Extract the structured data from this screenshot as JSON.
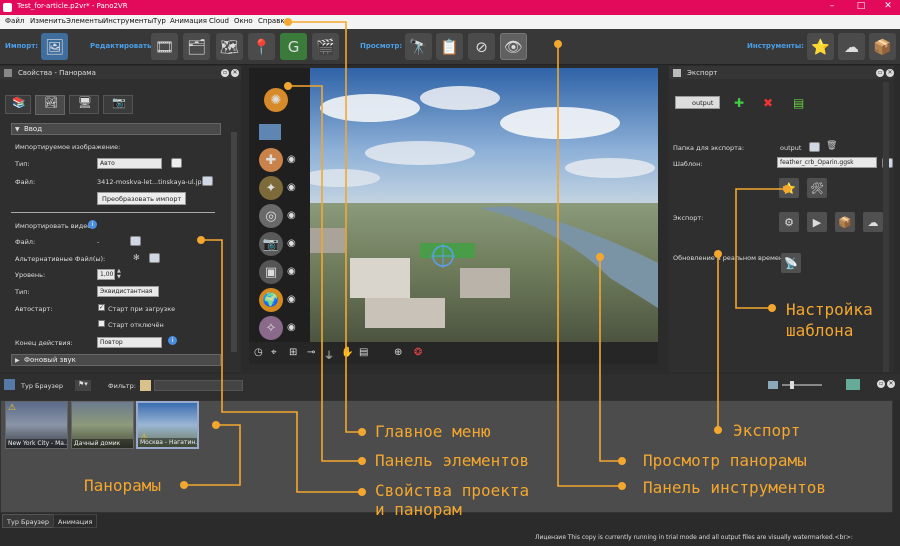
{
  "window": {
    "title": "Test_for-article.p2vr* - Pano2VR"
  },
  "menu": [
    "Файл",
    "Изменить",
    "Элементы",
    "Инструменты",
    "Тур",
    "Анимация",
    "Cloud",
    "Окно",
    "Справка"
  ],
  "toolbar": {
    "import_label": "Импорт:",
    "edit_label": "Редактировать:",
    "view_label": "Просмотр:",
    "tools_label": "Инструменты:"
  },
  "props": {
    "title": "Свойства - Панорама",
    "section_input": "Ввод",
    "imported_image": "Импортируемое изображение:",
    "type_label": "Тип:",
    "type_value": "Авто",
    "file_label": "Файл:",
    "file_value": "3412-moskva-let...tinskaya-ul.jpg",
    "convert_button": "Преобразовать импорт",
    "imported_video": "Импортировать видео:",
    "video_file_label": "Файл:",
    "video_file_value": "-",
    "alt_files_label": "Альтернативные Файл(ы):",
    "level_label": "Уровень:",
    "level_value": "1,00",
    "vtype_label": "Тип:",
    "vtype_value": "Эквидистантная",
    "autostart_label": "Автостарт:",
    "autostart_opt1": "Старт при загрузке",
    "autostart_opt2": "Старт отключён",
    "end_action_label": "Конец действия:",
    "end_action_value": "Повтор",
    "section_bg": "Фоновый звук"
  },
  "export": {
    "title": "Экспорт",
    "output_button": "output",
    "folder_label": "Папка для экспорта:",
    "folder_value": "output",
    "template_label": "Шаблон:",
    "template_value": "feather_crb_Oparin.ggsk",
    "export_label": "Экспорт:",
    "realtime_label": "Обновление в реальном времени:"
  },
  "tourbrowser": {
    "title": "Тур Браузер",
    "filter_label": "Фильтр:",
    "items": [
      "New York City - Ma...",
      "Дачный домик",
      "Москва - Нагатин..."
    ]
  },
  "bottom_tabs": [
    "Тур Браузер",
    "Анимация"
  ],
  "status": "Лицензия This copy is currently running in trial mode and all output files are visually watermarked.<br>:",
  "callouts": {
    "main_menu": "Главное меню",
    "elements": "Панель элементов",
    "props_line1": "Свойства проекта",
    "props_line2": "и панорам",
    "panoramas": "Панорамы",
    "export": "Экспорт",
    "preview": "Просмотр панорамы",
    "tools": "Панель инструментов",
    "template_line1": "Настройка",
    "template_line2": "шаблона"
  },
  "colors": {
    "accent": "#f3a72f",
    "titlebar": "#e30a5c",
    "label_blue": "#4a9fe8"
  }
}
